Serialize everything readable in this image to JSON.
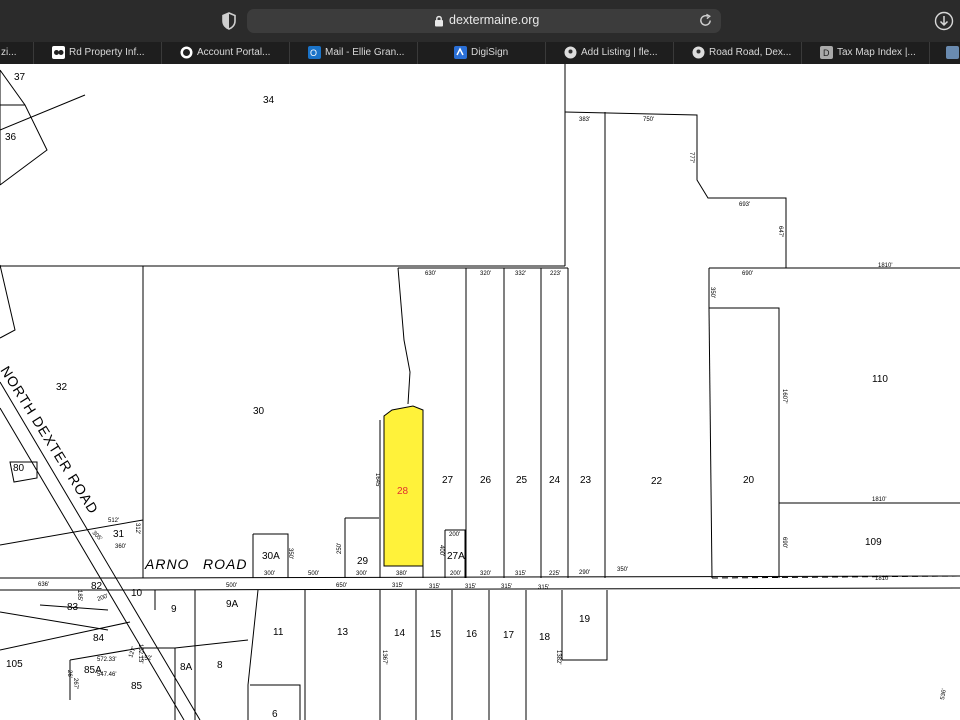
{
  "browser": {
    "url": "dextermaine.org",
    "tabs": [
      {
        "label": "zi...",
        "icon": "zillow-icon"
      },
      {
        "label": "Rd Property Inf...",
        "icon": "property-icon"
      },
      {
        "label": "Account Portal...",
        "icon": "portal-icon"
      },
      {
        "label": "Mail - Ellie Gran...",
        "icon": "outlook-icon"
      },
      {
        "label": "DigiSign",
        "icon": "digisign-icon"
      },
      {
        "label": "Add Listing | fle...",
        "icon": "location-pin-icon"
      },
      {
        "label": "Road Road, Dex...",
        "icon": "location-pin-icon"
      },
      {
        "label": "Tax Map Index |...",
        "icon": "tax-map-icon"
      }
    ]
  },
  "colors": {
    "chrome_bg": "#2b2b2b",
    "tab_bg": "#1e1e1e",
    "highlight": "#fff23a"
  },
  "map": {
    "roads": {
      "north_dexter": "NORTH DEXTER ROAD",
      "arno_word1": "ARNO",
      "arno_word2": "ROAD"
    },
    "lots": {
      "l37": "37",
      "l36": "36",
      "l34": "34",
      "l32": "32",
      "l30": "30",
      "l28": "28",
      "l27": "27",
      "l26": "26",
      "l25": "25",
      "l24": "24",
      "l23": "23",
      "l22": "22",
      "l20": "20",
      "l110": "110",
      "l109": "109",
      "l80": "80",
      "l31": "31",
      "l30a": "30A",
      "l29": "29",
      "l27a": "27A",
      "l82": "82",
      "l83": "83",
      "l84": "84",
      "l85a": "85A",
      "l85": "85",
      "l105": "105",
      "l10": "10",
      "l9": "9",
      "l9a": "9A",
      "l8a": "8A",
      "l8": "8",
      "l11": "11",
      "l13": "13",
      "l14": "14",
      "l15": "15",
      "l16": "16",
      "l17": "17",
      "l18": "18",
      "l19": "19",
      "l6": "6"
    },
    "dims": {
      "d383": "383'",
      "d750": "750'",
      "d777": "777'",
      "d693": "693'",
      "d647": "647'",
      "d630": "630'",
      "d320a": "320'",
      "d332": "332'",
      "d223": "223'",
      "d690": "690'",
      "d1810a": "1810'",
      "d350": "350'",
      "d1607": "1607'",
      "d1645": "1645'",
      "d1810b": "1810'",
      "d690b": "690'",
      "d200a": "200'",
      "d400": "400'",
      "d512": "512'",
      "d312": "312'",
      "d305": "305'",
      "d360": "360'",
      "d350b": "350'",
      "d250": "250'",
      "d300a": "300'",
      "d500a": "500'",
      "d300b": "300'",
      "d380": "380'",
      "d200b": "200'",
      "d320b": "320'",
      "d315a": "315'",
      "d225": "225'",
      "d290": "290'",
      "d350c": "350'",
      "d1810c": "1810'",
      "d636": "636'",
      "d185": "185'",
      "d200c": "200'",
      "d500b": "500'",
      "d650": "650'",
      "d315b": "315'",
      "d315c": "315'",
      "d315d": "315'",
      "d315e": "315'",
      "d315f": "315'",
      "d1367": "1367'",
      "d1382": "1382'",
      "d15213": "152.13'",
      "d572": "572.33'",
      "d152": "152'",
      "d547": "547.46'",
      "d127": "127'",
      "d26": "26'",
      "d267": "267'",
      "d536": "536'"
    }
  }
}
